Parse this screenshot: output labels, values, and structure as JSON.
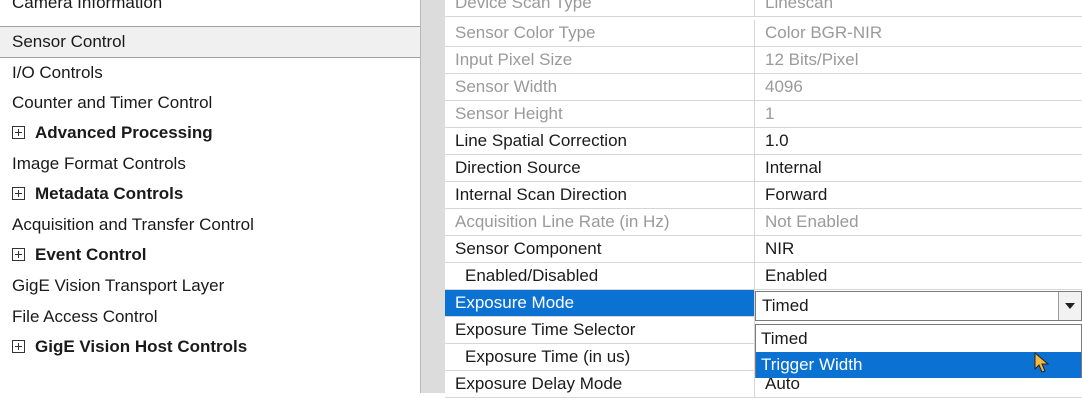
{
  "categories": [
    {
      "label": "Camera Information",
      "expandable": false
    },
    {
      "label": "Sensor Control",
      "expandable": false,
      "selected": true
    },
    {
      "label": "I/O Controls",
      "expandable": false
    },
    {
      "label": "Counter and Timer Control",
      "expandable": false
    },
    {
      "label": "Advanced Processing",
      "expandable": true
    },
    {
      "label": "Image Format Controls",
      "expandable": false
    },
    {
      "label": "Metadata Controls",
      "expandable": true
    },
    {
      "label": "Acquisition and Transfer Control",
      "expandable": false
    },
    {
      "label": "Event Control",
      "expandable": true
    },
    {
      "label": "GigE Vision Transport Layer",
      "expandable": false
    },
    {
      "label": "File Access Control",
      "expandable": false
    },
    {
      "label": "GigE Vision Host Controls",
      "expandable": true
    }
  ],
  "properties": [
    {
      "name": "Device Scan Type",
      "value": "Linescan",
      "disabled": true
    },
    {
      "name": "Sensor Color Type",
      "value": "Color BGR-NIR",
      "disabled": true
    },
    {
      "name": "Input Pixel Size",
      "value": "12 Bits/Pixel",
      "disabled": true
    },
    {
      "name": "Sensor Width",
      "value": "4096",
      "disabled": true
    },
    {
      "name": "Sensor Height",
      "value": "1",
      "disabled": true
    },
    {
      "name": "Line Spatial Correction",
      "value": "1.0"
    },
    {
      "name": "Direction Source",
      "value": "Internal"
    },
    {
      "name": "Internal Scan Direction",
      "value": "Forward"
    },
    {
      "name": "Acquisition Line Rate (in Hz)",
      "value": "Not Enabled",
      "disabled": true
    },
    {
      "name": "Sensor Component",
      "value": "NIR"
    },
    {
      "name": "Enabled/Disabled",
      "value": "Enabled",
      "indent": true
    },
    {
      "name": "Exposure Mode",
      "value": "Timed",
      "highlight": true
    },
    {
      "name": "Exposure Time Selector",
      "value": ""
    },
    {
      "name": "Exposure Time (in us)",
      "value": "",
      "indent": true
    },
    {
      "name": "Exposure Delay Mode",
      "value": "Auto"
    }
  ],
  "exposure_mode_combo": {
    "selected": "Timed",
    "options": [
      "Timed",
      "Trigger Width"
    ],
    "hovered": "Trigger Width"
  },
  "colors": {
    "selection": "#0b72d4",
    "disabled_text": "#9a9a9a"
  }
}
